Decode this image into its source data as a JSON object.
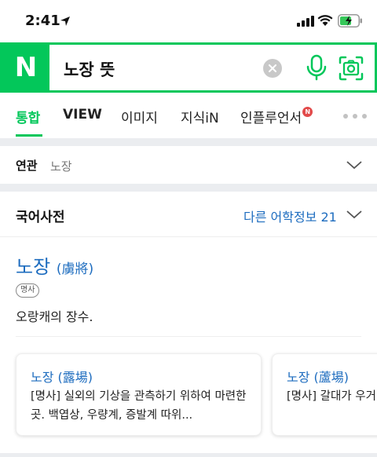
{
  "status_bar": {
    "time": "2:41"
  },
  "search": {
    "query": "노장 뜻",
    "logo_letter": "N"
  },
  "tabs": [
    {
      "label": "통합",
      "active": true
    },
    {
      "label": "VIEW"
    },
    {
      "label": "이미지"
    },
    {
      "label": "지식iN"
    },
    {
      "label": "인플루언서",
      "badge": "N"
    }
  ],
  "related": {
    "label": "연관",
    "term": "노장"
  },
  "dictionary": {
    "title": "국어사전",
    "more_label": "다른 어학정보 21",
    "entry": {
      "word": "노장",
      "hanja": "(虜將)",
      "pos": "명사",
      "definition": "오랑캐의 장수."
    },
    "cards": [
      {
        "word": "노장 (露場)",
        "desc": "[명사] 실외의 기상을 관측하기 위하여 마련한 곳. 백엽상, 우량계, 증발계 따위..."
      },
      {
        "word": "노장 (蘆場)",
        "desc": "[명사] 갈대가 우거"
      }
    ]
  },
  "colors": {
    "brand": "#03c75a",
    "link": "#1d6cbf",
    "badge": "#e24a4a"
  }
}
